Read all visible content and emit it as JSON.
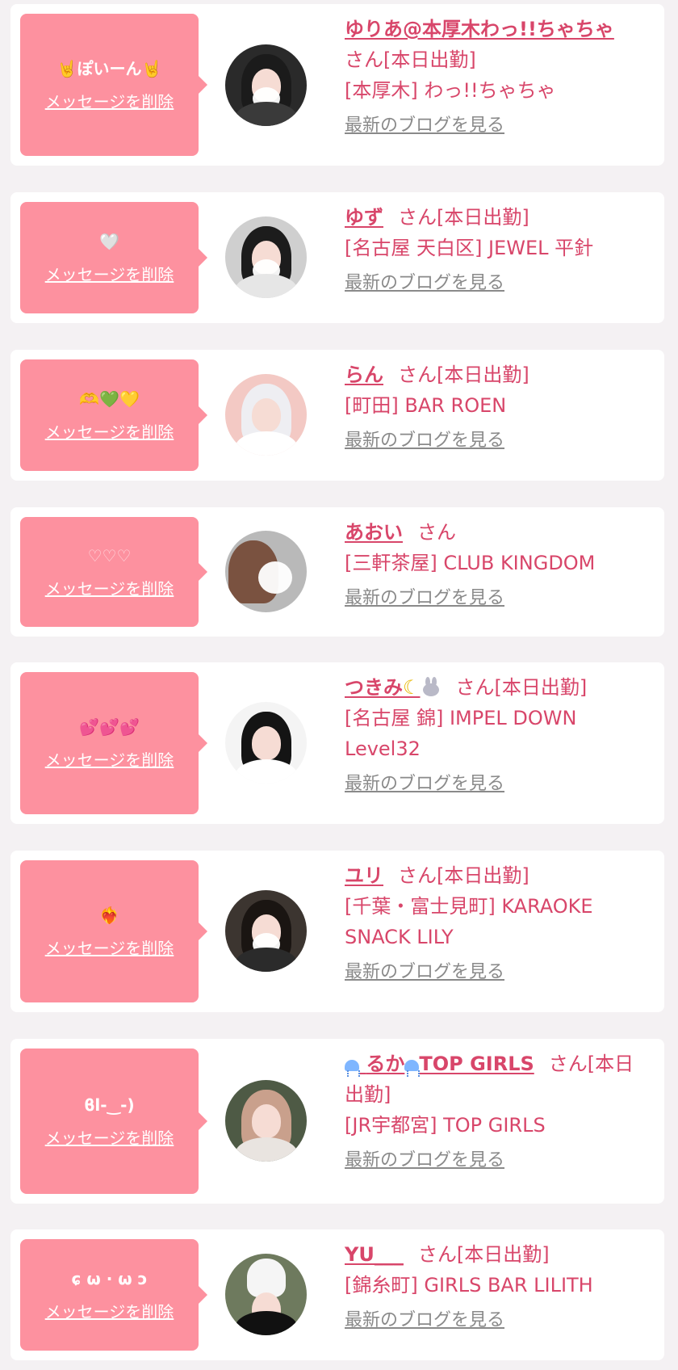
{
  "delete_label": "メッセージを削除",
  "blog_label": "最新のブログを見る",
  "suffix": "さん",
  "status": "[本日出勤]",
  "colors": {
    "bubble": "#fd919f",
    "accent": "#d8466a",
    "link_gray": "#8a8a8a",
    "card_bg": "#ffffff",
    "page_bg": "#f4f1f3"
  },
  "cards": [
    {
      "message": "🤘ぽいーん🤘",
      "name": "ゆりあ@本厚木わっ!!ちゃちゃ",
      "status": "[本日出勤]",
      "shop": "[本厚木] わっ!!ちゃちゃ",
      "avatar_icon": "girl-avatar-icon"
    },
    {
      "message": "🤍",
      "name": "ゆず",
      "status": "[本日出勤]",
      "shop": "[名古屋 天白区] JEWEL 平針",
      "avatar_icon": "girl-avatar-icon"
    },
    {
      "message": "🫶💚💛",
      "name": "らん",
      "status": "[本日出勤]",
      "shop": "[町田] BAR ROEN",
      "avatar_icon": "girl-avatar-icon"
    },
    {
      "message": "♡♡♡",
      "name": "あおい",
      "status": "",
      "shop": "[三軒茶屋] CLUB KINGDOM",
      "avatar_icon": "girl-avatar-icon"
    },
    {
      "message": "💕💕💕",
      "name": "つきみ",
      "name_icons": [
        "moon-icon",
        "bunny-icon"
      ],
      "status": "[本日出勤]",
      "shop": "[名古屋 錦] IMPEL DOWN Level32",
      "avatar_icon": "girl-avatar-icon"
    },
    {
      "message": "❤️‍🔥",
      "name": "ユリ",
      "status": "[本日出勤]",
      "shop": "[千葉・富士見町] KARAOKE SNACK LILY",
      "avatar_icon": "girl-avatar-icon"
    },
    {
      "message": "ϐl-‿-)",
      "name_prefix_icon": "jellyfish-icon",
      "name_a": "るか",
      "name_b": "TOP GIRLS",
      "status": "[本日出勤]",
      "shop": "[JR宇都宮] TOP GIRLS",
      "avatar_icon": "girl-avatar-icon"
    },
    {
      "message": "ɕ ω · ω ɔ",
      "name": "YU___",
      "status": "[本日出勤]",
      "shop": "[錦糸町] GIRLS BAR LILITH",
      "avatar_icon": "girl-avatar-icon"
    }
  ]
}
